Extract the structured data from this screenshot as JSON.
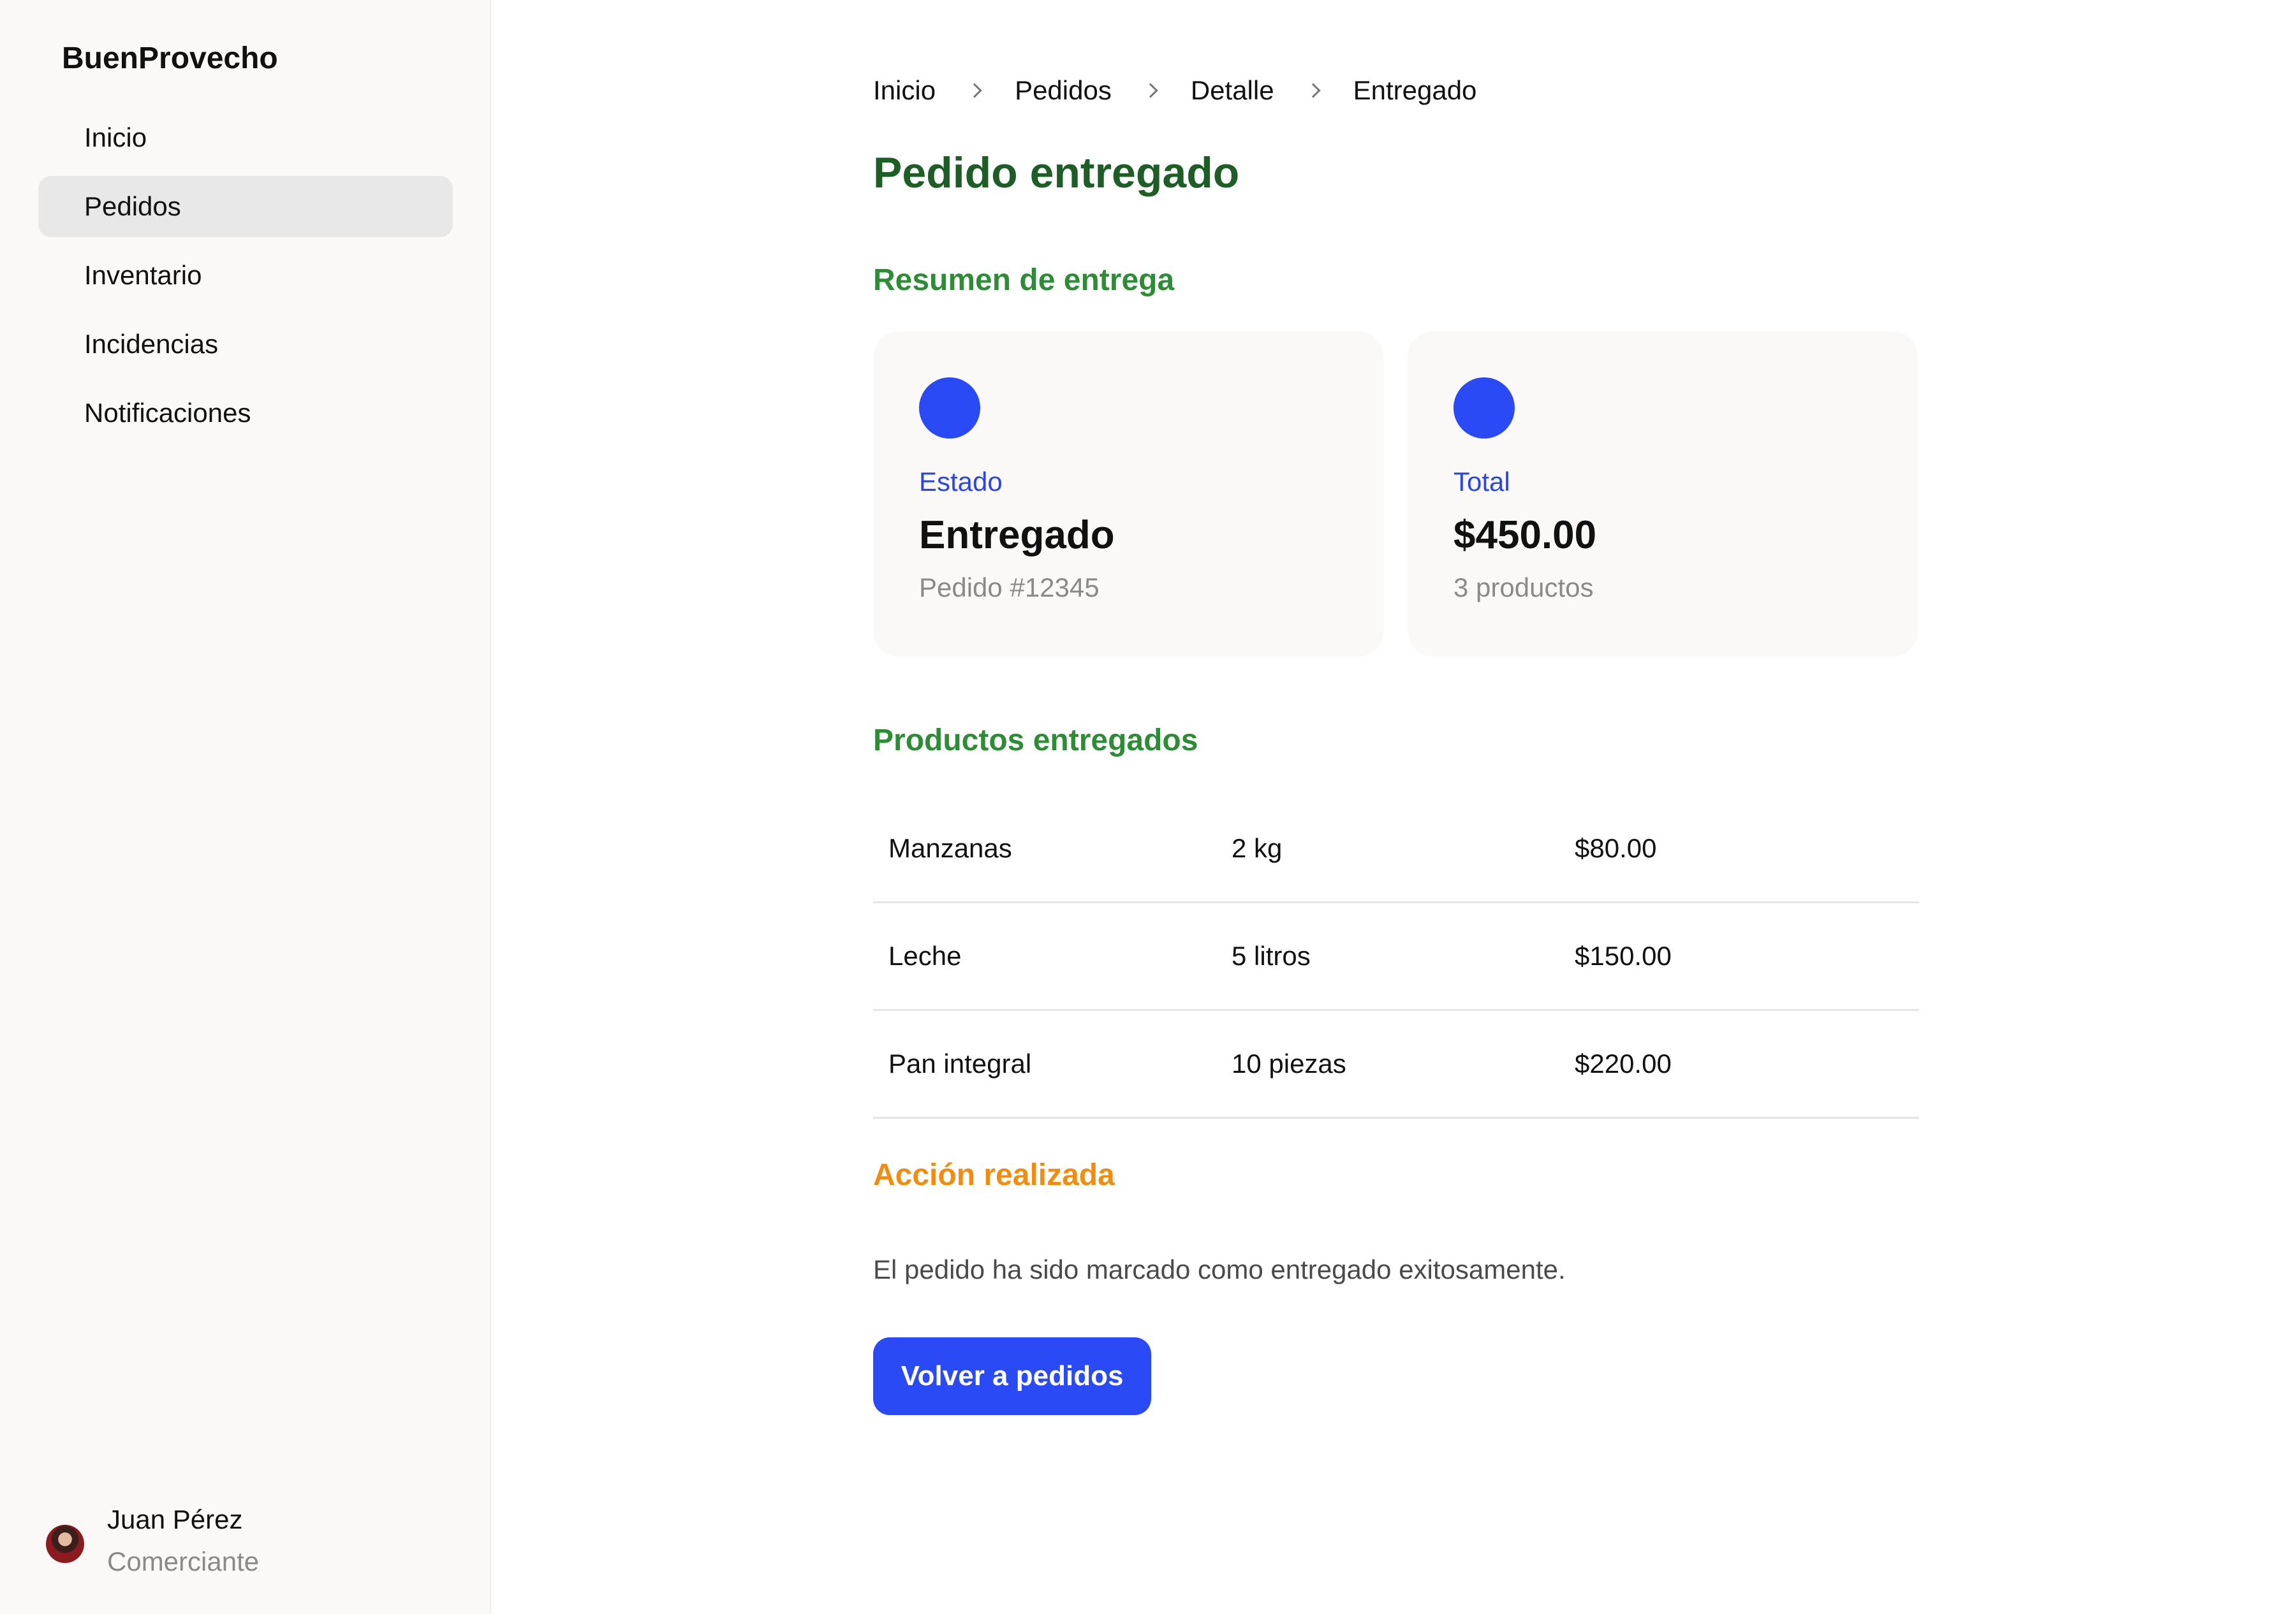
{
  "sidebar": {
    "brand": "BuenProvecho",
    "items": [
      {
        "label": "Inicio",
        "active": false
      },
      {
        "label": "Pedidos",
        "active": true
      },
      {
        "label": "Inventario",
        "active": false
      },
      {
        "label": "Incidencias",
        "active": false
      },
      {
        "label": "Notificaciones",
        "active": false
      }
    ],
    "user": {
      "name": "Juan Pérez",
      "role": "Comerciante"
    }
  },
  "breadcrumb": [
    "Inicio",
    "Pedidos",
    "Detalle",
    "Entregado"
  ],
  "page_title": "Pedido entregado",
  "summary": {
    "title": "Resumen de entrega",
    "cards": [
      {
        "label": "Estado",
        "value": "Entregado",
        "sub": "Pedido #12345"
      },
      {
        "label": "Total",
        "value": "$450.00",
        "sub": "3 productos"
      }
    ]
  },
  "products": {
    "title": "Productos entregados",
    "rows": [
      {
        "name": "Manzanas",
        "qty": "2 kg",
        "price": "$80.00"
      },
      {
        "name": "Leche",
        "qty": "5 litros",
        "price": "$150.00"
      },
      {
        "name": "Pan integral",
        "qty": "10 piezas",
        "price": "$220.00"
      }
    ]
  },
  "action": {
    "title": "Acción realizada",
    "message": "El pedido ha sido marcado como entregado exitosamente.",
    "button_label": "Volver a pedidos"
  },
  "colors": {
    "title_green": "#1e5e26",
    "section_green": "#2e8b36",
    "section_orange": "#f28c0f",
    "accent_blue": "#2a4af5"
  }
}
